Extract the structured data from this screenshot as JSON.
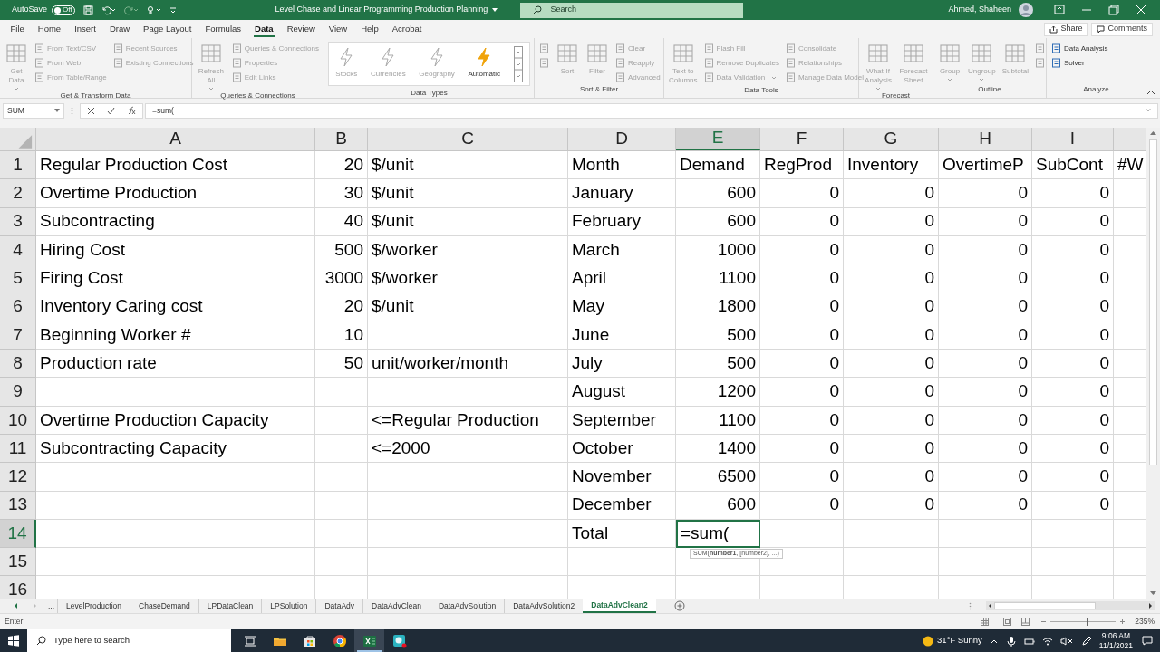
{
  "title_bar": {
    "autosave_label": "AutoSave",
    "autosave": {
      "label": "Off",
      "on": false
    },
    "title": "Level Chase and Linear Programming Production Planning",
    "search_placeholder": "Search",
    "user": "Ahmed, Shaheen"
  },
  "menu_tabs": [
    {
      "label": "File",
      "selected": false
    },
    {
      "label": "Home",
      "selected": false
    },
    {
      "label": "Insert",
      "selected": false
    },
    {
      "label": "Draw",
      "selected": false
    },
    {
      "label": "Page Layout",
      "selected": false
    },
    {
      "label": "Formulas",
      "selected": false
    },
    {
      "label": "Data",
      "selected": true
    },
    {
      "label": "Review",
      "selected": false
    },
    {
      "label": "View",
      "selected": false
    },
    {
      "label": "Help",
      "selected": false
    },
    {
      "label": "Acrobat",
      "selected": false
    }
  ],
  "share": "Share",
  "comments": "Comments",
  "ribbon": {
    "groups": [
      {
        "label": "Get & Transform Data",
        "kind": "buttons",
        "columns": [
          [
            {
              "kind": "large",
              "label": "Get Data",
              "dropdown": true,
              "disabled": true
            }
          ],
          [
            {
              "kind": "small",
              "label": "From Text/CSV",
              "dropdown": false,
              "disabled": true
            },
            {
              "kind": "small",
              "label": "From Web",
              "dropdown": false,
              "disabled": true
            },
            {
              "kind": "small",
              "label": "From Table/Range",
              "dropdown": false,
              "disabled": true
            }
          ],
          [
            {
              "kind": "small",
              "label": "Recent Sources",
              "dropdown": false,
              "disabled": true
            },
            {
              "kind": "small",
              "label": "Existing Connections",
              "dropdown": false,
              "disabled": true
            }
          ]
        ]
      },
      {
        "label": "Queries & Connections",
        "kind": "buttons",
        "columns": [
          [
            {
              "kind": "large",
              "label": "Refresh All",
              "dropdown": true,
              "disabled": true
            }
          ],
          [
            {
              "kind": "small",
              "label": "Queries & Connections",
              "dropdown": false,
              "disabled": true
            },
            {
              "kind": "small",
              "label": "Properties",
              "dropdown": false,
              "disabled": true
            },
            {
              "kind": "small",
              "label": "Edit Links",
              "dropdown": false,
              "disabled": true
            }
          ]
        ]
      },
      {
        "label": "Data Types",
        "kind": "gallery",
        "columns": [
          [
            {
              "kind": "large",
              "label": "Stocks",
              "dropdown": false,
              "disabled": true
            }
          ],
          [
            {
              "kind": "large",
              "label": "Currencies",
              "dropdown": false,
              "disabled": true
            }
          ],
          [
            {
              "kind": "large",
              "label": "Geography",
              "dropdown": false,
              "disabled": true
            }
          ],
          [
            {
              "kind": "large",
              "label": "Automatic",
              "dropdown": false,
              "disabled": false
            }
          ]
        ]
      },
      {
        "label": "Sort & Filter",
        "kind": "buttons",
        "columns": [
          [
            {
              "kind": "small",
              "dropdown": false,
              "disabled": true
            },
            {
              "kind": "small",
              "dropdown": false,
              "disabled": true
            }
          ],
          [
            {
              "kind": "large",
              "label": "Sort",
              "dropdown": false,
              "disabled": true
            }
          ],
          [
            {
              "kind": "large",
              "label": "Filter",
              "dropdown": false,
              "disabled": true
            }
          ],
          [
            {
              "kind": "small",
              "label": "Clear",
              "dropdown": false,
              "disabled": true
            },
            {
              "kind": "small",
              "label": "Reapply",
              "dropdown": false,
              "disabled": true
            },
            {
              "kind": "small",
              "label": "Advanced",
              "dropdown": false,
              "disabled": true
            }
          ]
        ]
      },
      {
        "label": "Data Tools",
        "kind": "buttons",
        "columns": [
          [
            {
              "kind": "large",
              "label": "Text to Columns",
              "dropdown": false,
              "disabled": true
            }
          ],
          [
            {
              "kind": "small",
              "label": "Flash Fill",
              "dropdown": false,
              "disabled": true
            },
            {
              "kind": "small",
              "label": "Remove Duplicates",
              "dropdown": false,
              "disabled": true
            },
            {
              "kind": "small",
              "label": "Data Validation",
              "dropdown": true,
              "disabled": true
            }
          ],
          [
            {
              "kind": "small",
              "label": "Consolidate",
              "dropdown": false,
              "disabled": true
            },
            {
              "kind": "small",
              "label": "Relationships",
              "dropdown": false,
              "disabled": true
            },
            {
              "kind": "small",
              "label": "Manage Data Model",
              "dropdown": false,
              "disabled": true
            }
          ]
        ]
      },
      {
        "label": "Forecast",
        "kind": "buttons",
        "columns": [
          [
            {
              "kind": "large",
              "label": "What-If Analysis",
              "dropdown": true,
              "disabled": true
            }
          ],
          [
            {
              "kind": "large",
              "label": "Forecast Sheet",
              "dropdown": false,
              "disabled": true
            }
          ]
        ]
      },
      {
        "label": "Outline",
        "kind": "buttons",
        "columns": [
          [
            {
              "kind": "large",
              "label": "Group",
              "dropdown": true,
              "disabled": true
            }
          ],
          [
            {
              "kind": "large",
              "label": "Ungroup",
              "dropdown": true,
              "disabled": true
            }
          ],
          [
            {
              "kind": "large",
              "label": "Subtotal",
              "dropdown": false,
              "disabled": true
            }
          ],
          [
            {
              "kind": "small",
              "dropdown": false,
              "disabled": true
            },
            {
              "kind": "small",
              "dropdown": false,
              "disabled": true
            }
          ]
        ]
      },
      {
        "label": "Analyze",
        "kind": "buttons",
        "columns": [
          [
            {
              "kind": "small",
              "label": "Data Analysis",
              "dropdown": false,
              "disabled": false
            },
            {
              "kind": "small",
              "label": "Solver",
              "dropdown": false,
              "disabled": false
            }
          ]
        ]
      }
    ]
  },
  "formula_bar": {
    "name_box": "SUM",
    "formula": "=sum("
  },
  "sheet": {
    "columns": [
      {
        "letter": "A",
        "selected": false
      },
      {
        "letter": "B",
        "selected": false
      },
      {
        "letter": "C",
        "selected": false
      },
      {
        "letter": "D",
        "selected": false
      },
      {
        "letter": "E",
        "selected": true
      },
      {
        "letter": "F",
        "selected": false
      },
      {
        "letter": "G",
        "selected": false
      },
      {
        "letter": "H",
        "selected": false
      },
      {
        "letter": "I",
        "selected": false
      }
    ],
    "rows": [
      {
        "number": "1",
        "selected": false,
        "cells": [
          "Regular Production Cost",
          "20",
          "$/unit",
          "Month",
          "Demand",
          "RegProd",
          "Inventory",
          "OvertimeP",
          "SubCont",
          "#W"
        ]
      },
      {
        "number": "2",
        "selected": false,
        "cells": [
          "Overtime Production",
          "30",
          "$/unit",
          "January",
          "600",
          "0",
          "0",
          "0",
          "0",
          null
        ]
      },
      {
        "number": "3",
        "selected": false,
        "cells": [
          "Subcontracting",
          "40",
          "$/unit",
          "February",
          "600",
          "0",
          "0",
          "0",
          "0",
          null
        ]
      },
      {
        "number": "4",
        "selected": false,
        "cells": [
          "Hiring Cost",
          "500",
          "$/worker",
          "March",
          "1000",
          "0",
          "0",
          "0",
          "0",
          null
        ]
      },
      {
        "number": "5",
        "selected": false,
        "cells": [
          "Firing Cost",
          "3000",
          "$/worker",
          "April",
          "1100",
          "0",
          "0",
          "0",
          "0",
          null
        ]
      },
      {
        "number": "6",
        "selected": false,
        "cells": [
          "Inventory Caring cost",
          "20",
          "$/unit",
          "May",
          "1800",
          "0",
          "0",
          "0",
          "0",
          null
        ]
      },
      {
        "number": "7",
        "selected": false,
        "cells": [
          "Beginning Worker #",
          "10",
          null,
          "June",
          "500",
          "0",
          "0",
          "0",
          "0",
          null
        ]
      },
      {
        "number": "8",
        "selected": false,
        "cells": [
          "Production rate",
          "50",
          "unit/worker/month",
          "July",
          "500",
          "0",
          "0",
          "0",
          "0",
          null
        ]
      },
      {
        "number": "9",
        "selected": false,
        "cells": [
          null,
          null,
          null,
          "August",
          "1200",
          "0",
          "0",
          "0",
          "0",
          null
        ]
      },
      {
        "number": "10",
        "selected": false,
        "cells": [
          "Overtime Production Capacity",
          null,
          "<=Regular Production",
          "September",
          "1100",
          "0",
          "0",
          "0",
          "0",
          null
        ]
      },
      {
        "number": "11",
        "selected": false,
        "cells": [
          "Subcontracting Capacity",
          null,
          "<=2000",
          "October",
          "1400",
          "0",
          "0",
          "0",
          "0",
          null
        ]
      },
      {
        "number": "12",
        "selected": false,
        "cells": [
          null,
          null,
          null,
          "November",
          "6500",
          "0",
          "0",
          "0",
          "0",
          null
        ]
      },
      {
        "number": "13",
        "selected": false,
        "cells": [
          null,
          null,
          null,
          "December",
          "600",
          "0",
          "0",
          "0",
          "0",
          null
        ]
      },
      {
        "number": "14",
        "selected": true,
        "cells": [
          null,
          null,
          null,
          "Total",
          "=sum(",
          null,
          null,
          null,
          null,
          null
        ]
      },
      {
        "number": "15",
        "selected": false,
        "cells": [
          null,
          null,
          null,
          null,
          null,
          null,
          null,
          null,
          null,
          null
        ]
      },
      {
        "number": "16",
        "selected": false,
        "cells": [
          null,
          null,
          null,
          null,
          null,
          null,
          null,
          null,
          null,
          null
        ]
      }
    ],
    "tooltip": "SUM(**number1**, [number2], ...)"
  },
  "sheet_tabs": {
    "more": "...",
    "tabs": [
      {
        "label": "LevelProduction",
        "selected": false
      },
      {
        "label": "ChaseDemand",
        "selected": false
      },
      {
        "label": "LPDataClean",
        "selected": false
      },
      {
        "label": "LPSolution",
        "selected": false
      },
      {
        "label": "DataAdv",
        "selected": false
      },
      {
        "label": "DataAdvClean",
        "selected": false
      },
      {
        "label": "DataAdvSolution",
        "selected": false
      },
      {
        "label": "DataAdvSolution2",
        "selected": false
      },
      {
        "label": "DataAdvClean2",
        "selected": true
      }
    ]
  },
  "status_bar": {
    "mode": "Enter",
    "zoom": "235%",
    "zoom_slider": {
      "level": 0.55
    }
  },
  "taskbar": {
    "search_placeholder": "Type here to search",
    "apps": [
      {
        "kind": "task_view",
        "selected": false
      },
      {
        "kind": "explorer",
        "selected": false
      },
      {
        "kind": "store",
        "selected": false
      },
      {
        "kind": "chrome",
        "selected": false
      },
      {
        "kind": "excel",
        "selected": true
      },
      {
        "kind": "recorder",
        "selected": false
      }
    ],
    "weather": "31°F Sunny",
    "time": "9:06 AM",
    "date": "11/1/2021"
  }
}
